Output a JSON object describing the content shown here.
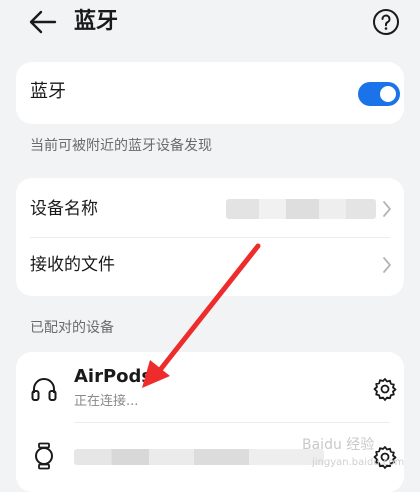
{
  "header": {
    "title": "蓝牙"
  },
  "bluetooth": {
    "label": "蓝牙",
    "enabled": true,
    "accent": "#1a73e8"
  },
  "discoverable_hint": "当前可被附近的蓝牙设备发现",
  "settings": {
    "device_name_label": "设备名称",
    "received_files_label": "接收的文件"
  },
  "paired": {
    "section_title": "已配对的设备",
    "devices": [
      {
        "name": "AirPods",
        "status": "正在连接...",
        "icon": "headphones-icon"
      },
      {
        "icon": "watch-icon"
      }
    ]
  },
  "watermark": {
    "text": "Baidu 经验",
    "sub": "jingyan.baidu.com"
  },
  "annotation": {
    "arrow_color": "#ee2c2c"
  }
}
